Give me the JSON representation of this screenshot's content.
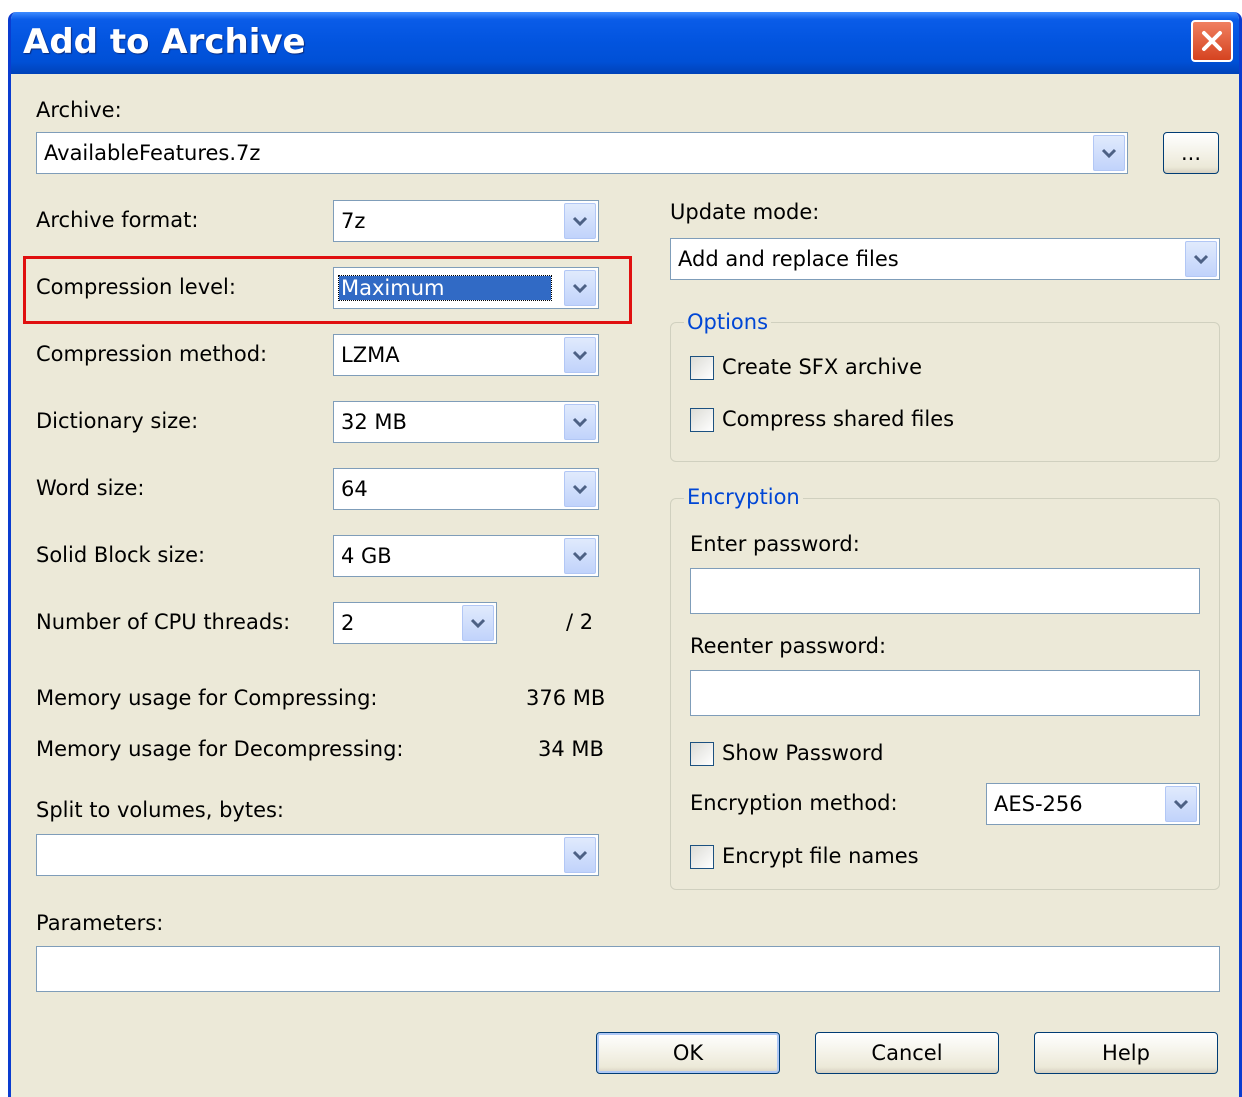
{
  "window": {
    "title": "Add to Archive"
  },
  "archive": {
    "label": "Archive:",
    "value": "AvailableFeatures.7z",
    "browse_label": "..."
  },
  "left": {
    "archive_format": {
      "label": "Archive format:",
      "value": "7z"
    },
    "compression_level": {
      "label": "Compression level:",
      "value": "Maximum"
    },
    "compression_method": {
      "label": "Compression method:",
      "value": "LZMA"
    },
    "dictionary_size": {
      "label": "Dictionary size:",
      "value": "32 MB"
    },
    "word_size": {
      "label": "Word size:",
      "value": "64"
    },
    "solid_block_size": {
      "label": "Solid Block size:",
      "value": "4 GB"
    },
    "cpu_threads": {
      "label": "Number of CPU threads:",
      "value": "2",
      "max": "/ 2"
    },
    "mem_compress": {
      "label": "Memory usage for Compressing:",
      "value": "376 MB"
    },
    "mem_decompress": {
      "label": "Memory usage for Decompressing:",
      "value": "34 MB"
    },
    "split_volumes": {
      "label": "Split to volumes, bytes:",
      "value": ""
    }
  },
  "right": {
    "update_mode": {
      "label": "Update mode:",
      "value": "Add and replace files"
    },
    "options": {
      "legend": "Options",
      "create_sfx": "Create SFX archive",
      "compress_shared": "Compress shared files"
    },
    "encryption": {
      "legend": "Encryption",
      "enter_password": "Enter password:",
      "reenter_password": "Reenter password:",
      "show_password": "Show Password",
      "method_label": "Encryption method:",
      "method_value": "AES-256",
      "encrypt_names": "Encrypt file names"
    }
  },
  "parameters": {
    "label": "Parameters:",
    "value": ""
  },
  "buttons": {
    "ok": "OK",
    "cancel": "Cancel",
    "help": "Help"
  },
  "colors": {
    "title_bar": "#0355e0",
    "highlight": "#316ac5",
    "annotation_box": "#e01010",
    "dialog_bg": "#ece9d8"
  },
  "icons": {
    "close": "close-icon",
    "dropdown": "chevron-down-icon"
  }
}
